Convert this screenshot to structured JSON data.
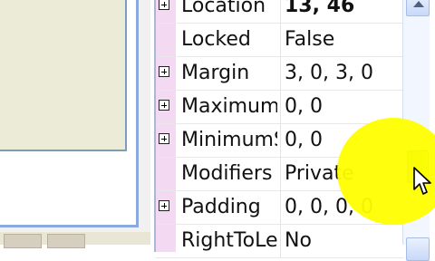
{
  "properties": [
    {
      "name": "Location",
      "value": "13, 46",
      "expandable": true,
      "bold_value": true
    },
    {
      "name": "Locked",
      "value": "False",
      "expandable": false,
      "bold_value": false
    },
    {
      "name": "Margin",
      "value": "3, 0, 3, 0",
      "expandable": true,
      "bold_value": false
    },
    {
      "name": "MaximumSize",
      "value": "0, 0",
      "expandable": true,
      "bold_value": false
    },
    {
      "name": "MinimumSize",
      "value": "0, 0",
      "expandable": true,
      "bold_value": false
    },
    {
      "name": "Modifiers",
      "value": "Private",
      "expandable": false,
      "bold_value": false
    },
    {
      "name": "Padding",
      "value": "0, 0, 0, 0",
      "expandable": true,
      "bold_value": false
    },
    {
      "name": "RightToLeft",
      "value": "No",
      "expandable": false,
      "bold_value": false
    }
  ],
  "colors": {
    "category_margin": "#f4d9f2",
    "grid_border": "#a8b8d8",
    "cursor_highlight": "#ffff00",
    "scroll_thumb": "#8fc463"
  },
  "icons": {
    "expander": "plus-box-icon",
    "scroll_up": "arrow-up-icon",
    "scroll_down": "arrow-down-icon",
    "cursor": "mouse-pointer-icon"
  }
}
